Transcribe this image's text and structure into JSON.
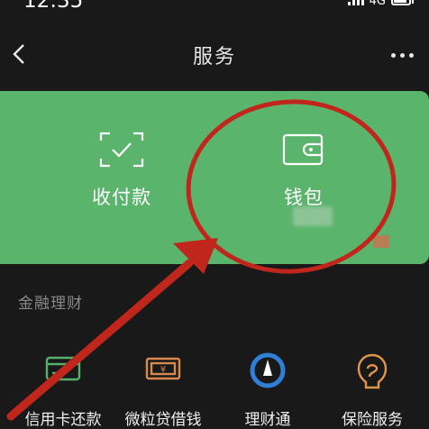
{
  "status_bar": {
    "time": "12:35",
    "network": "4G"
  },
  "nav": {
    "title": "服务"
  },
  "card": {
    "items": [
      {
        "label": "收付款",
        "icon": "scan-pay-icon"
      },
      {
        "label": "钱包",
        "icon": "wallet-icon"
      }
    ]
  },
  "finance_section": {
    "title": "金融理财",
    "items": [
      {
        "label": "信用卡还款",
        "icon": "credit-card-icon"
      },
      {
        "label": "微粒贷借钱",
        "icon": "loan-icon"
      },
      {
        "label": "理财通",
        "icon": "wealth-icon"
      },
      {
        "label": "保险服务",
        "icon": "insurance-icon"
      }
    ]
  },
  "colors": {
    "background": "#191919",
    "card": "#5bb46c",
    "annotation": "#c0261c"
  }
}
